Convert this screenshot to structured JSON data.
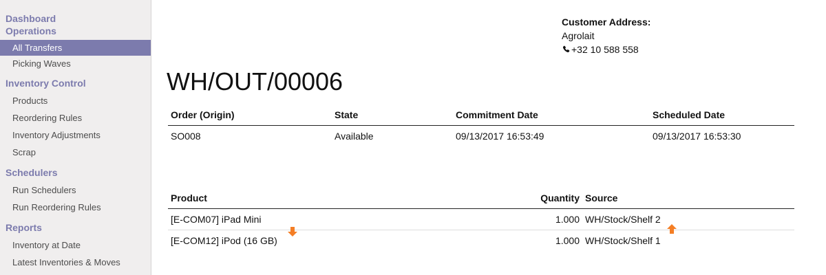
{
  "sidebar": {
    "sections": [
      {
        "header": "Dashboard"
      },
      {
        "header": "Operations",
        "items": [
          "All Transfers",
          "Picking Waves"
        ]
      },
      {
        "header": "Inventory Control",
        "items": [
          "Products",
          "Reordering Rules",
          "Inventory Adjustments",
          "Scrap"
        ]
      },
      {
        "header": "Schedulers",
        "items": [
          "Run Schedulers",
          "Run Reordering Rules"
        ]
      },
      {
        "header": "Reports",
        "items": [
          "Inventory at Date",
          "Latest Inventories & Moves"
        ]
      }
    ],
    "active_item": "All Transfers"
  },
  "customer": {
    "label": "Customer Address:",
    "name": "Agrolait",
    "phone": "+32 10 588 558",
    "phone_icon": "phone-icon"
  },
  "document": {
    "title": "WH/OUT/00006"
  },
  "order_table": {
    "headers": [
      "Order (Origin)",
      "State",
      "Commitment Date",
      "Scheduled Date"
    ],
    "row": [
      "SO008",
      "Available",
      "09/13/2017 16:53:49",
      "09/13/2017 16:53:30"
    ]
  },
  "product_table": {
    "headers": [
      "Product",
      "Quantity",
      "Source"
    ],
    "rows": [
      [
        "[E-COM07] iPad Mini",
        "1.000",
        "WH/Stock/Shelf 2"
      ],
      [
        "[E-COM12] iPod (16 GB)",
        "1.000",
        "WH/Stock/Shelf 1"
      ]
    ]
  },
  "colors": {
    "sidebar_accent": "#7c7bad",
    "arrow": "#f47e25"
  }
}
